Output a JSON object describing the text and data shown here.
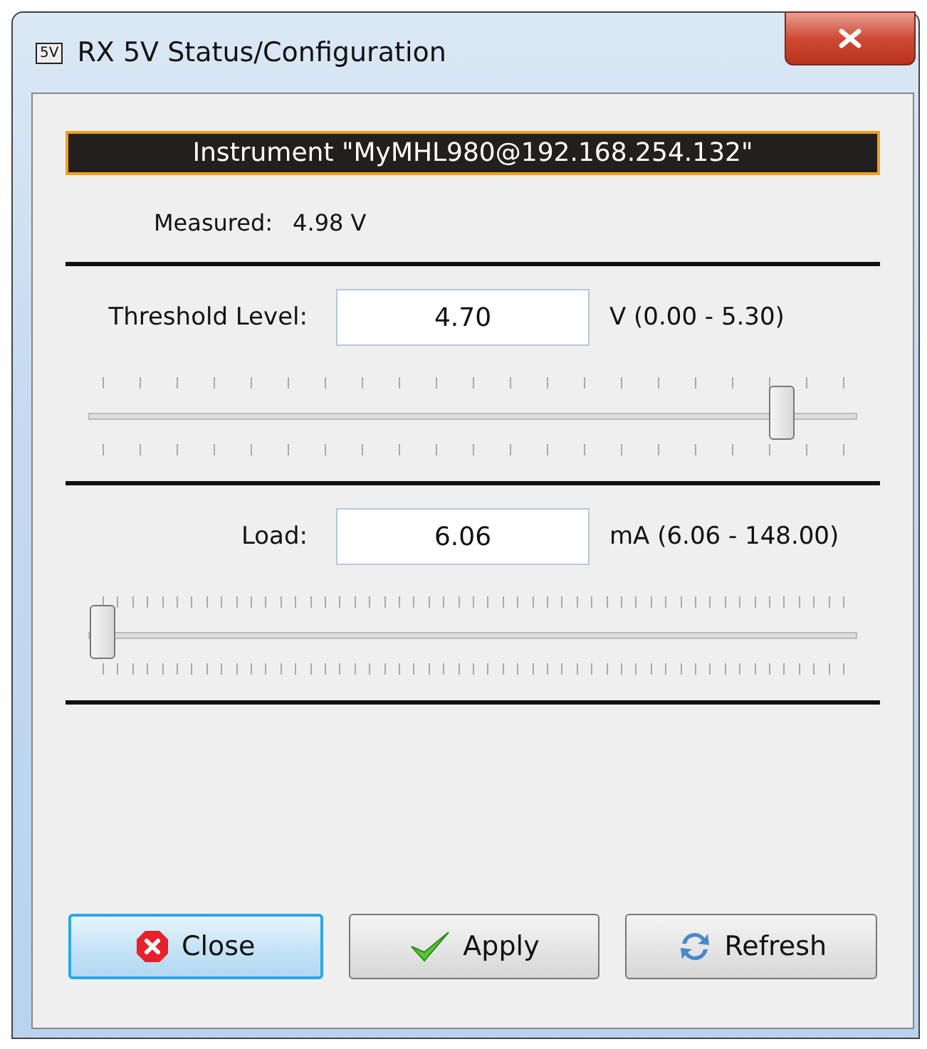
{
  "window": {
    "title_icon": "5V",
    "title": "RX 5V Status/Configuration"
  },
  "instrument": "Instrument \"MyMHL980@192.168.254.132\"",
  "measured": {
    "label": "Measured:",
    "value": "4.98 V"
  },
  "controls": [
    {
      "label": "Threshold Level:",
      "value": "4.70",
      "range": "V (0.00 - 5.30)",
      "level": 0.887
    },
    {
      "label": "Load:",
      "value": "6.06",
      "range": "mA (6.06 - 148.00)",
      "level": 0
    }
  ],
  "buttons": [
    {
      "label": "Close",
      "kind": "close",
      "selected": true
    },
    {
      "label": "Apply",
      "kind": "apply",
      "selected": false
    },
    {
      "label": "Refresh",
      "kind": "refresh",
      "selected": false
    }
  ]
}
